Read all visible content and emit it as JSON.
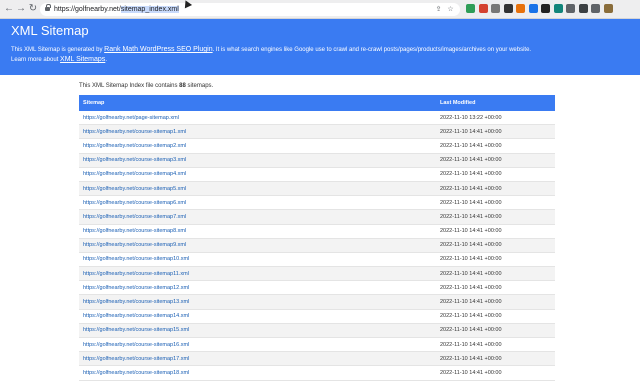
{
  "browser": {
    "url_prefix": "https://golfnearby.net/",
    "url_selected": "sitemap_index.xml",
    "back_icon": "back-arrow-icon",
    "forward_icon": "forward-arrow-icon",
    "reload_icon": "reload-icon"
  },
  "header": {
    "title": "XML Sitemap",
    "desc_1": "This XML Sitemap is generated by",
    "desc_link": "Rank Math WordPress SEO Plugin",
    "desc_2": ". It is what search engines like Google use to crawl and re-crawl posts/pages/products/images/archives on your website.",
    "learn_text": "Learn more about",
    "learn_link": "XML Sitemaps",
    "learn_end": "."
  },
  "intro": {
    "prefix": "This XML Sitemap Index file contains",
    "count": "88",
    "suffix": "sitemaps."
  },
  "table": {
    "col_sitemap": "Sitemap",
    "col_modified": "Last Modified",
    "rows": [
      {
        "loc": "https://golfnearby.net/page-sitemap.xml",
        "mod": "2022-11-10 13:22 +00:00"
      },
      {
        "loc": "https://golfnearby.net/course-sitemap1.xml",
        "mod": "2022-11-10 14:41 +00:00"
      },
      {
        "loc": "https://golfnearby.net/course-sitemap2.xml",
        "mod": "2022-11-10 14:41 +00:00"
      },
      {
        "loc": "https://golfnearby.net/course-sitemap3.xml",
        "mod": "2022-11-10 14:41 +00:00"
      },
      {
        "loc": "https://golfnearby.net/course-sitemap4.xml",
        "mod": "2022-11-10 14:41 +00:00"
      },
      {
        "loc": "https://golfnearby.net/course-sitemap5.xml",
        "mod": "2022-11-10 14:41 +00:00"
      },
      {
        "loc": "https://golfnearby.net/course-sitemap6.xml",
        "mod": "2022-11-10 14:41 +00:00"
      },
      {
        "loc": "https://golfnearby.net/course-sitemap7.xml",
        "mod": "2022-11-10 14:41 +00:00"
      },
      {
        "loc": "https://golfnearby.net/course-sitemap8.xml",
        "mod": "2022-11-10 14:41 +00:00"
      },
      {
        "loc": "https://golfnearby.net/course-sitemap9.xml",
        "mod": "2022-11-10 14:41 +00:00"
      },
      {
        "loc": "https://golfnearby.net/course-sitemap10.xml",
        "mod": "2022-11-10 14:41 +00:00"
      },
      {
        "loc": "https://golfnearby.net/course-sitemap11.xml",
        "mod": "2022-11-10 14:41 +00:00"
      },
      {
        "loc": "https://golfnearby.net/course-sitemap12.xml",
        "mod": "2022-11-10 14:41 +00:00"
      },
      {
        "loc": "https://golfnearby.net/course-sitemap13.xml",
        "mod": "2022-11-10 14:41 +00:00"
      },
      {
        "loc": "https://golfnearby.net/course-sitemap14.xml",
        "mod": "2022-11-10 14:41 +00:00"
      },
      {
        "loc": "https://golfnearby.net/course-sitemap15.xml",
        "mod": "2022-11-10 14:41 +00:00"
      },
      {
        "loc": "https://golfnearby.net/course-sitemap16.xml",
        "mod": "2022-11-10 14:41 +00:00"
      },
      {
        "loc": "https://golfnearby.net/course-sitemap17.xml",
        "mod": "2022-11-10 14:41 +00:00"
      },
      {
        "loc": "https://golfnearby.net/course-sitemap18.xml",
        "mod": "2022-11-10 14:41 +00:00"
      }
    ]
  },
  "extensions": [
    {
      "icon": "extension-green-icon",
      "color": "#2e9d57"
    },
    {
      "icon": "extension-red-icon",
      "color": "#d4412f"
    },
    {
      "icon": "extension-grey-icon",
      "color": "#777777"
    },
    {
      "icon": "extension-dark-icon",
      "color": "#333333"
    },
    {
      "icon": "extension-orange-icon",
      "color": "#e8710a"
    },
    {
      "icon": "extension-blue-icon",
      "color": "#1a73e8"
    },
    {
      "icon": "extension-black-icon",
      "color": "#222222"
    },
    {
      "icon": "extension-teal-icon",
      "color": "#12857a"
    },
    {
      "icon": "extension-grey2-icon",
      "color": "#5f6368"
    },
    {
      "icon": "extension-dark2-icon",
      "color": "#3c4043"
    },
    {
      "icon": "puzzle-icon",
      "color": "#5f6368"
    },
    {
      "icon": "profile-icon",
      "color": "#8a6d3b"
    }
  ]
}
